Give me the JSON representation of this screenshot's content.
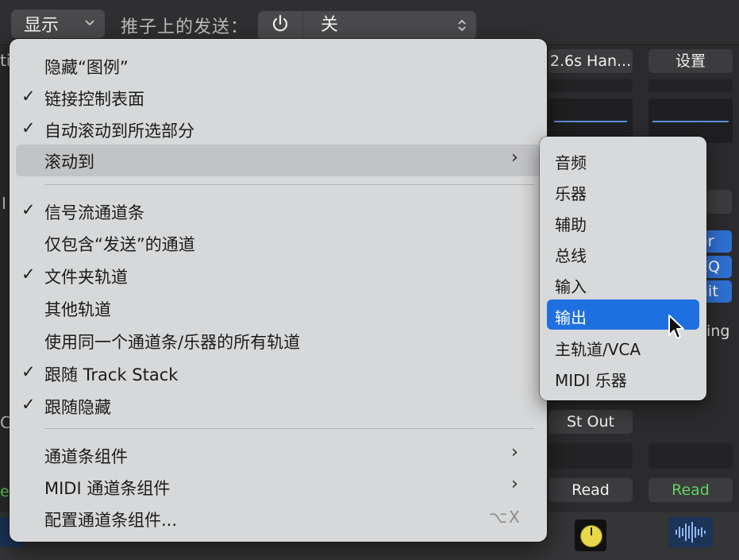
{
  "toolbar": {
    "view_label": "显示",
    "view_chevron": "⌵",
    "sends_label": "推子上的发送：",
    "sends_value": "关"
  },
  "strips": {
    "top_button_left": "2.6s Han...",
    "top_button_right": "设置",
    "blue_tag_1": "or",
    "blue_tag_2": "EQ",
    "blue_tag_3": "nit",
    "right_partial_text": "ing",
    "left_partial_top": "ti",
    "left_partial_mid": "I",
    "left_partial_c": "C",
    "left_partial_ea": "ea",
    "output_button": "St Out",
    "read_left": "Read",
    "read_right": "Read"
  },
  "menu": {
    "items": [
      {
        "checked": false,
        "label": "隐藏“图例”",
        "has_submenu": false
      },
      {
        "checked": true,
        "label": "链接控制表面",
        "has_submenu": false
      },
      {
        "checked": true,
        "label": "自动滚动到所选部分",
        "has_submenu": false
      },
      {
        "checked": false,
        "label": "滚动到",
        "has_submenu": true,
        "highlighted": true
      },
      {
        "checked": true,
        "label": "信号流通道条",
        "has_submenu": false
      },
      {
        "checked": false,
        "label": "仅包含“发送”的通道",
        "has_submenu": false
      },
      {
        "checked": true,
        "label": "文件夹轨道",
        "has_submenu": false
      },
      {
        "checked": false,
        "label": "其他轨道",
        "has_submenu": false
      },
      {
        "checked": false,
        "label": "使用同一个通道条/乐器的所有轨道",
        "has_submenu": false
      },
      {
        "checked": true,
        "label": "跟随 Track Stack",
        "has_submenu": false
      },
      {
        "checked": true,
        "label": "跟随隐藏",
        "has_submenu": false
      },
      {
        "checked": false,
        "label": "通道条组件",
        "has_submenu": true
      },
      {
        "checked": false,
        "label": "MIDI 通道条组件",
        "has_submenu": true
      },
      {
        "checked": false,
        "label": "配置通道条组件...",
        "has_submenu": false,
        "shortcut": "⌥X"
      }
    ],
    "check_glyph": "✓",
    "arrow_glyph": "›"
  },
  "submenu": {
    "items": [
      {
        "label": "音频",
        "selected": false
      },
      {
        "label": "乐器",
        "selected": false
      },
      {
        "label": "辅助",
        "selected": false
      },
      {
        "label": "总线",
        "selected": false
      },
      {
        "label": "输入",
        "selected": false
      },
      {
        "label": "输出",
        "selected": true
      },
      {
        "label": "主轨道/VCA",
        "selected": false
      },
      {
        "label": "MIDI 乐器",
        "selected": false
      }
    ]
  },
  "colors": {
    "menu_bg": "#d7d8d9",
    "selection_blue": "#1e6fe0",
    "read_green": "#5fd35f",
    "knob_yellow": "#e9d84a"
  },
  "icons": {
    "power": "power-icon",
    "chevron": "chevron-down-icon",
    "updown": "up-down-chevron-icon",
    "checkmark": "checkmark-icon",
    "submenu_arrow": "chevron-right-icon",
    "cursor": "mouse-pointer-icon"
  }
}
